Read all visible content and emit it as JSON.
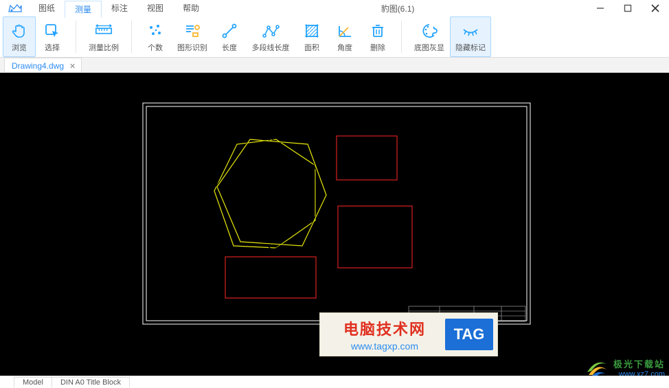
{
  "app": {
    "title": "豹图(6.1)"
  },
  "menu": {
    "items": [
      {
        "label": "图纸"
      },
      {
        "label": "测量",
        "active": true
      },
      {
        "label": "标注"
      },
      {
        "label": "视图"
      },
      {
        "label": "帮助"
      }
    ]
  },
  "ribbon": {
    "browse": "浏览",
    "select": "选择",
    "scale": "测量比例",
    "count": "个数",
    "shape_id": "图形识别",
    "length": "长度",
    "polyline": "多段线长度",
    "area": "面积",
    "angle": "角度",
    "delete": "删除",
    "basemap_gray": "底图灰显",
    "hide_marks": "隐藏标记"
  },
  "file_tab": {
    "name": "Drawing4.dwg"
  },
  "bottom_tabs": {
    "model": "Model",
    "layout": "DIN A0 Title Block"
  },
  "watermark1": {
    "title": "电脑技术网",
    "url": "www.tagxp.com",
    "tag": "TAG"
  },
  "watermark2": {
    "name": "极光下载站",
    "url": "www.xz7.com"
  }
}
